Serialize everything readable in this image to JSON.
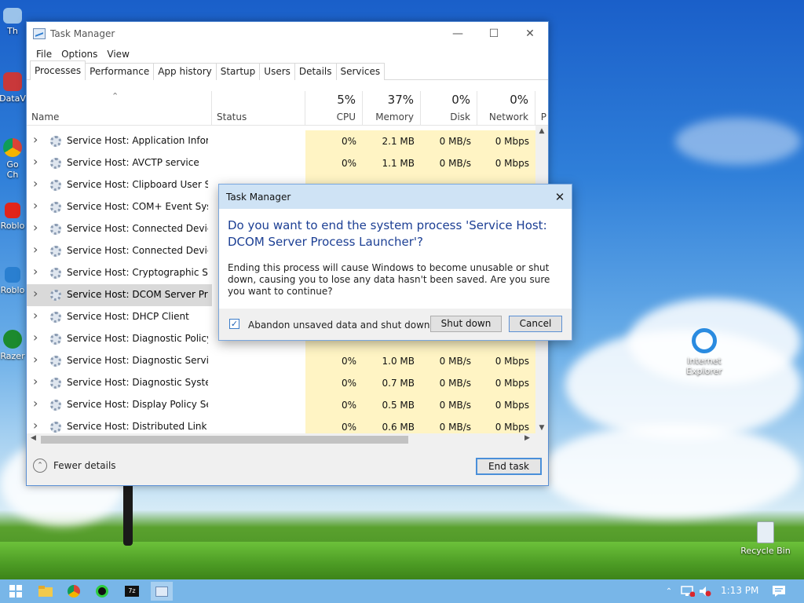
{
  "desktop": {
    "icons": [
      {
        "label": "Th"
      },
      {
        "label": "DataV"
      },
      {
        "label": "Go"
      },
      {
        "label": "Ch"
      },
      {
        "label": "Roblo"
      },
      {
        "label": "Roblo"
      },
      {
        "label": "Razer"
      },
      {
        "label": "Internet Explorer"
      },
      {
        "label": "Recycle Bin"
      }
    ]
  },
  "task_manager": {
    "title": "Task Manager",
    "menu": [
      "File",
      "Options",
      "View"
    ],
    "tabs": [
      "Processes",
      "Performance",
      "App history",
      "Startup",
      "Users",
      "Details",
      "Services"
    ],
    "active_tab": "Processes",
    "columns": {
      "name": "Name",
      "status": "Status",
      "cpu": {
        "pct": "5%",
        "label": "CPU"
      },
      "memory": {
        "pct": "37%",
        "label": "Memory"
      },
      "disk": {
        "pct": "0%",
        "label": "Disk"
      },
      "network": {
        "pct": "0%",
        "label": "Network"
      },
      "power": {
        "label": "P"
      }
    },
    "rows": [
      {
        "name": "Service Host: Application Infor...",
        "cpu": "0%",
        "memory": "2.1 MB",
        "disk": "0 MB/s",
        "network": "0 Mbps"
      },
      {
        "name": "Service Host: AVCTP service",
        "cpu": "0%",
        "memory": "1.1 MB",
        "disk": "0 MB/s",
        "network": "0 Mbps"
      },
      {
        "name": "Service Host: Clipboard User Ser...",
        "cpu": "",
        "memory": "",
        "disk": "",
        "network": ""
      },
      {
        "name": "Service Host: COM+ Event Syste...",
        "cpu": "",
        "memory": "",
        "disk": "",
        "network": ""
      },
      {
        "name": "Service Host: Connected Device...",
        "cpu": "",
        "memory": "",
        "disk": "",
        "network": ""
      },
      {
        "name": "Service Host: Connected Device...",
        "cpu": "",
        "memory": "",
        "disk": "",
        "network": ""
      },
      {
        "name": "Service Host: Cryptographic Ser...",
        "cpu": "",
        "memory": "",
        "disk": "",
        "network": ""
      },
      {
        "name": "Service Host: DCOM Server Proc...",
        "cpu": "",
        "memory": "",
        "disk": "",
        "network": "",
        "selected": true
      },
      {
        "name": "Service Host: DHCP Client",
        "cpu": "",
        "memory": "",
        "disk": "",
        "network": ""
      },
      {
        "name": "Service Host: Diagnostic Policy ...",
        "cpu": "",
        "memory": "",
        "disk": "",
        "network": ""
      },
      {
        "name": "Service Host: Diagnostic Service...",
        "cpu": "0%",
        "memory": "1.0 MB",
        "disk": "0 MB/s",
        "network": "0 Mbps"
      },
      {
        "name": "Service Host: Diagnostic System...",
        "cpu": "0%",
        "memory": "0.7 MB",
        "disk": "0 MB/s",
        "network": "0 Mbps"
      },
      {
        "name": "Service Host: Display Policy Serv...",
        "cpu": "0%",
        "memory": "0.5 MB",
        "disk": "0 MB/s",
        "network": "0 Mbps"
      },
      {
        "name": "Service Host: Distributed Link Tr...",
        "cpu": "0%",
        "memory": "0.6 MB",
        "disk": "0 MB/s",
        "network": "0 Mbps"
      }
    ],
    "fewer_details": "Fewer details",
    "end_task": "End task"
  },
  "dialog": {
    "title": "Task Manager",
    "instruction": "Do you want to end the system process 'Service Host: DCOM Server Process Launcher'?",
    "content": "Ending this process will cause Windows to become unusable or shut down, causing you to lose any data hasn't been saved. Are you sure you want to continue?",
    "checkbox_label": "Abandon unsaved data and shut down.",
    "checkbox_checked": true,
    "shutdown_label": "Shut down",
    "cancel_label": "Cancel"
  },
  "taskbar": {
    "clock": "1:13 PM"
  }
}
